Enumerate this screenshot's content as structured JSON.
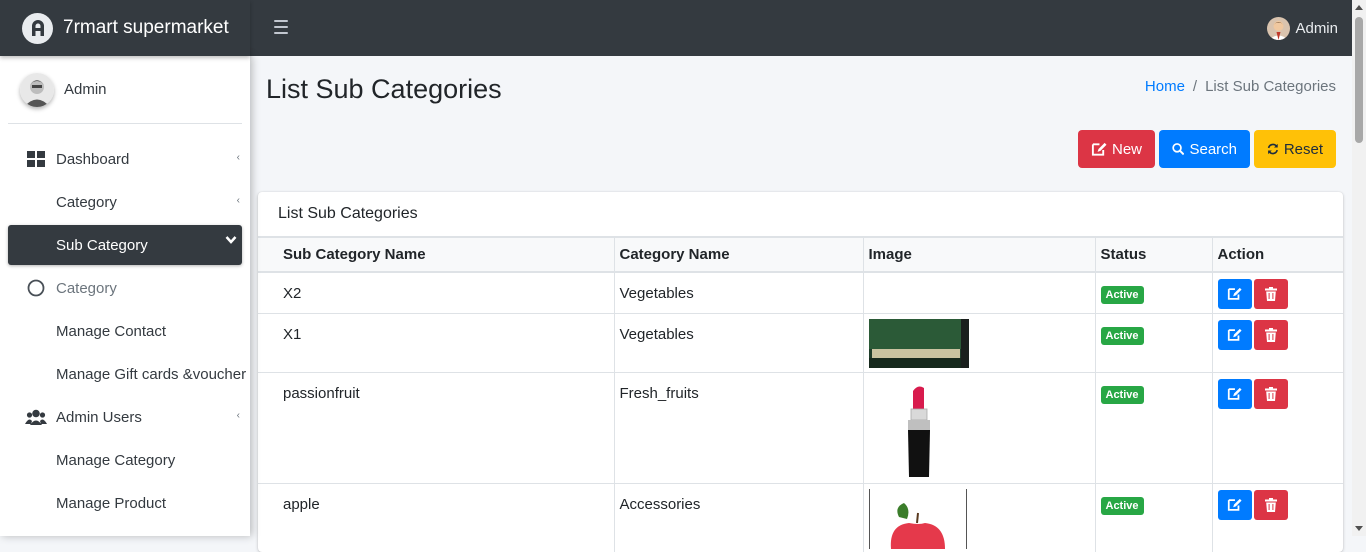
{
  "brand": {
    "name": "7rmart supermarket"
  },
  "sidebar": {
    "user": "Admin",
    "items": [
      {
        "label": "Dashboard",
        "icon": "grid-icon",
        "caret": true
      },
      {
        "label": "Category",
        "sub": true,
        "caret": true
      },
      {
        "label": "Sub Category",
        "sub": true,
        "active": true
      },
      {
        "label": "Category",
        "icon": "circle-icon",
        "muted": true
      },
      {
        "label": "Manage Contact",
        "sub": true
      },
      {
        "label": "Manage Gift cards &voucher",
        "sub": true
      },
      {
        "label": "Admin Users",
        "icon": "users-icon",
        "caret": true
      },
      {
        "label": "Manage Category",
        "sub": true
      },
      {
        "label": "Manage Product",
        "sub": true
      }
    ]
  },
  "topbar": {
    "user": "Admin"
  },
  "page": {
    "title": "List Sub Categories",
    "breadcrumb": {
      "home": "Home",
      "sep": "/",
      "current": "List Sub Categories"
    },
    "buttons": {
      "new": "New",
      "search": "Search",
      "reset": "Reset"
    }
  },
  "card": {
    "title": "List Sub Categories",
    "columns": [
      "Sub Category Name",
      "Category Name",
      "Image",
      "Status",
      "Action"
    ],
    "rows": [
      {
        "name": "X2",
        "category": "Vegetables",
        "image": "none",
        "status": "Active"
      },
      {
        "name": "X1",
        "category": "Vegetables",
        "image": "green-banner",
        "status": "Active"
      },
      {
        "name": "passionfruit",
        "category": "Fresh_fruits",
        "image": "lipstick",
        "status": "Active"
      },
      {
        "name": "apple",
        "category": "Accessories",
        "image": "apple",
        "status": "Active"
      }
    ]
  },
  "colors": {
    "primary": "#007bff",
    "danger": "#dc3545",
    "warning": "#ffc107",
    "success": "#28a745",
    "dark": "#343a40"
  }
}
